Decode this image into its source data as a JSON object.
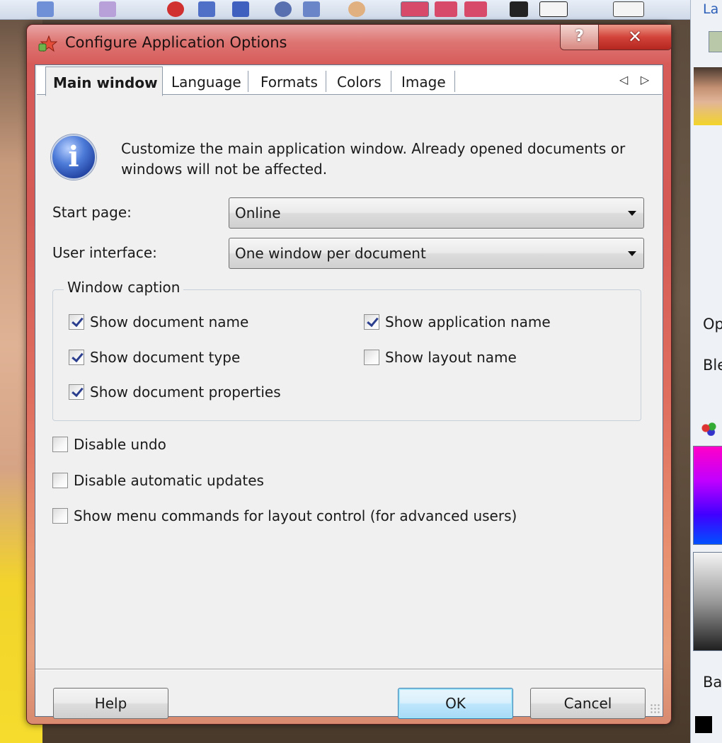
{
  "window": {
    "title": "Configure Application Options",
    "help_caption": "?",
    "close_caption": "✕"
  },
  "tabs": {
    "items": [
      {
        "label": "Main window",
        "selected": true
      },
      {
        "label": "Language",
        "selected": false
      },
      {
        "label": "Formats",
        "selected": false
      },
      {
        "label": "Colors",
        "selected": false
      },
      {
        "label": "Image",
        "selected": false
      }
    ],
    "scroll_left": "◁",
    "scroll_right": "▷"
  },
  "info": {
    "icon": "i",
    "text": "Customize the main application window. Already opened documents or windows will not be affected."
  },
  "fields": {
    "start_page": {
      "label": "Start page:",
      "value": "Online"
    },
    "user_interface": {
      "label": "User interface:",
      "value": "One window per document"
    }
  },
  "caption_group": {
    "label": "Window caption",
    "options": [
      {
        "label": "Show document name",
        "checked": true
      },
      {
        "label": "Show document type",
        "checked": true
      },
      {
        "label": "Show document properties",
        "checked": true
      },
      {
        "label": "Show application name",
        "checked": true
      },
      {
        "label": "Show layout name",
        "checked": false
      }
    ]
  },
  "options": [
    {
      "label": "Disable undo",
      "checked": false
    },
    {
      "label": "Disable automatic updates",
      "checked": false
    },
    {
      "label": "Show menu commands for layout control (for advanced users)",
      "checked": false
    }
  ],
  "buttons": {
    "help": "Help",
    "ok": "OK",
    "cancel": "Cancel"
  },
  "background": {
    "right_panel_texts": [
      "La",
      "Op",
      "Ble",
      "Bac"
    ]
  }
}
